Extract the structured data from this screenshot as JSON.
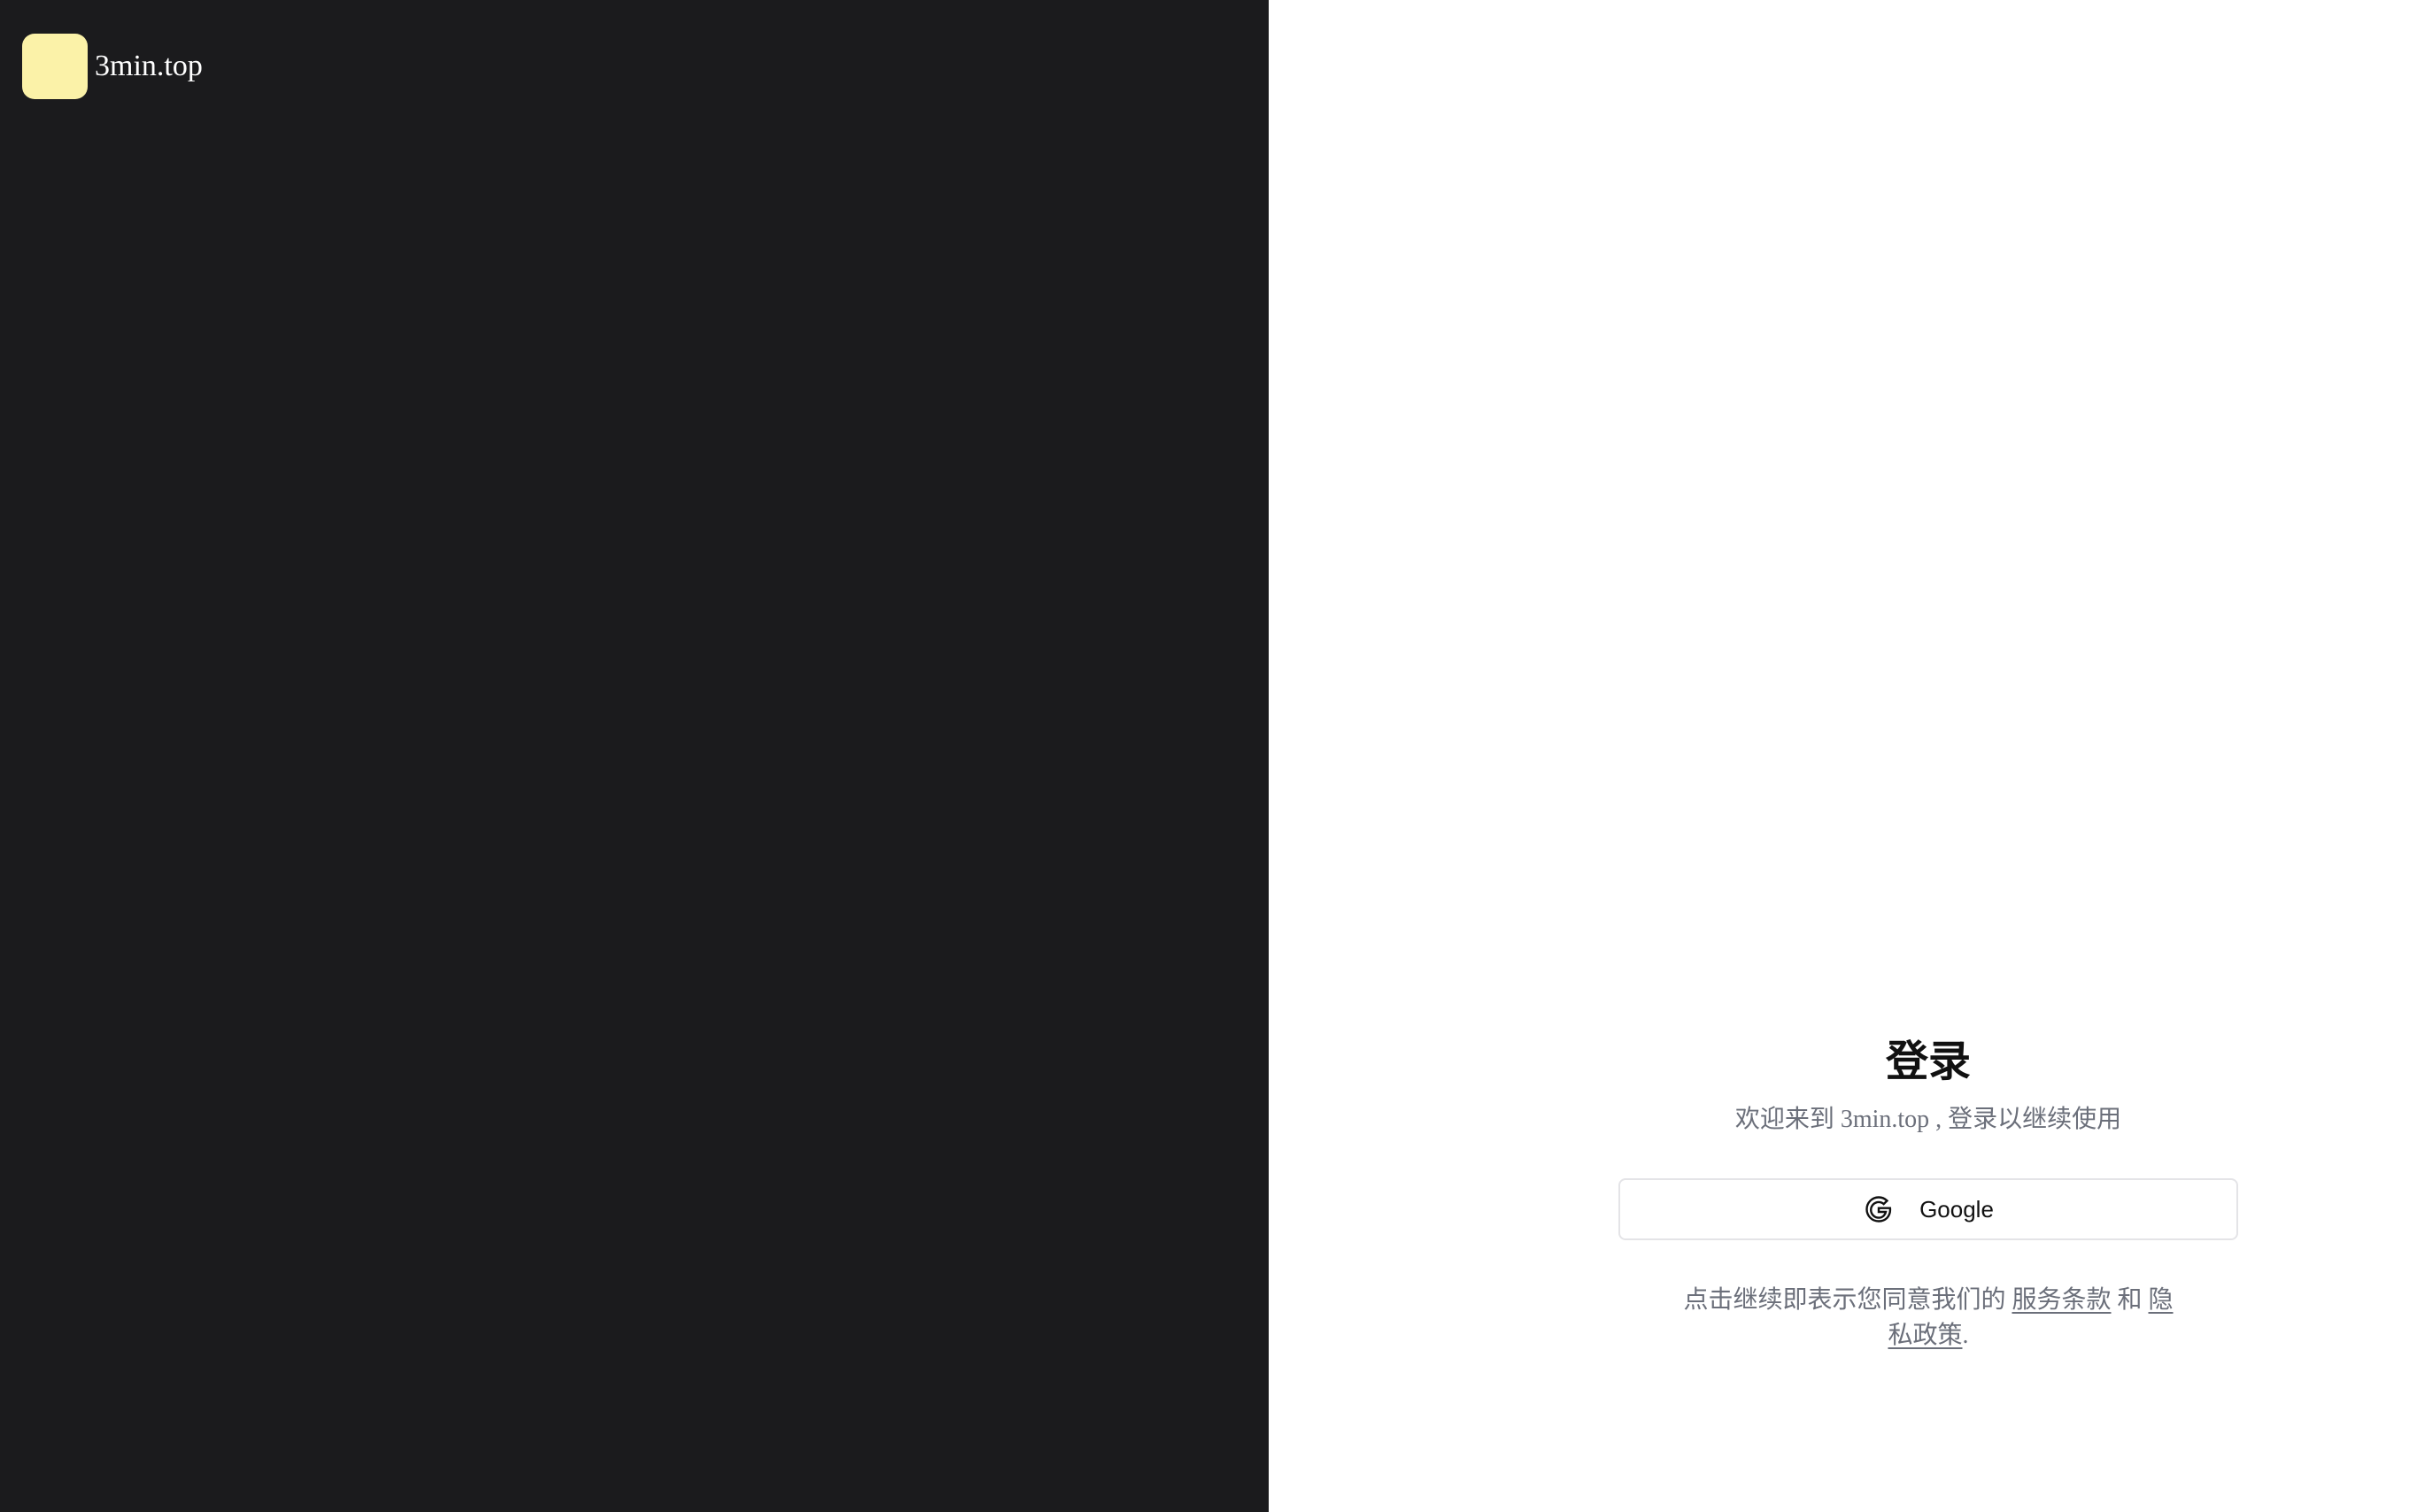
{
  "brand": {
    "name": "3min.top",
    "logo_color": "#fbf2a8"
  },
  "left_panel": {
    "background": "#1b1b1d"
  },
  "login": {
    "title": "登录",
    "subtitle": "欢迎来到 3min.top , 登录以继续使用",
    "google_button_label": "Google",
    "google_icon": "google-icon",
    "terms": {
      "prefix": "点击继续即表示您同意我们的 ",
      "terms_link": "服务条款",
      "conjunction": " 和 ",
      "privacy_link": "隐私政策",
      "suffix": "."
    }
  }
}
